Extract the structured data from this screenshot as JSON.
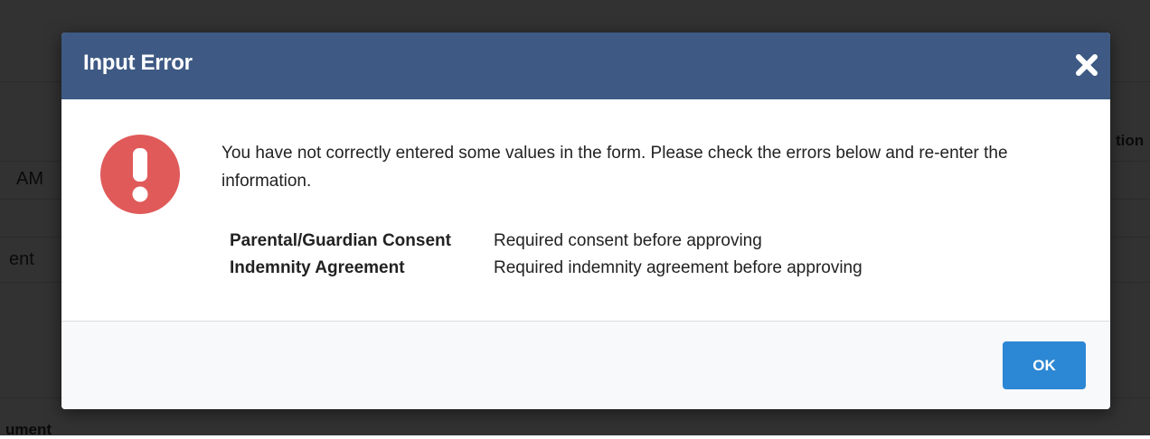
{
  "background": {
    "fragments": [
      "AM",
      "ent",
      "tion",
      "ument"
    ]
  },
  "dialog": {
    "title": "Input Error",
    "close_icon": "close-icon",
    "alert_icon": "exclamation-circle-icon",
    "message": "You have not correctly entered some values in the form. Please check the errors below and re-enter the information.",
    "errors": [
      {
        "field": "Parental/Guardian Consent",
        "message": "Required consent before approving"
      },
      {
        "field": "Indemnity Agreement",
        "message": "Required indemnity agreement before approving"
      }
    ],
    "ok_label": "OK"
  },
  "colors": {
    "header": "#3e5a84",
    "alert": "#e05a5a",
    "button": "#2c87d4",
    "footer": "#f8f9fb"
  }
}
